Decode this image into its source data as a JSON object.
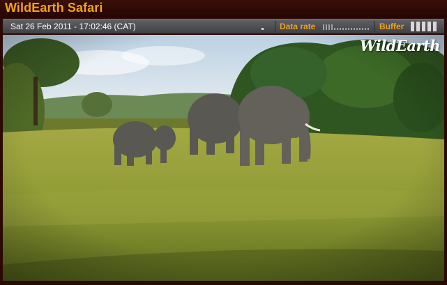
{
  "app": {
    "title": "WildEarth Safari"
  },
  "status": {
    "datetime": "Sat 26 Feb 2011 - 17:02:46 (CAT)",
    "data_rate_label": "Data rate",
    "buffer_label": "Buffer",
    "buffer_level": 1.0
  },
  "video": {
    "logo_text": "WildEarth"
  },
  "colors": {
    "accent": "#f2a316",
    "titlebar": "#2b0905",
    "infobar": "#4e5054"
  },
  "icons": [
    "data-rate-meter-icon",
    "buffer-meter-icon"
  ]
}
